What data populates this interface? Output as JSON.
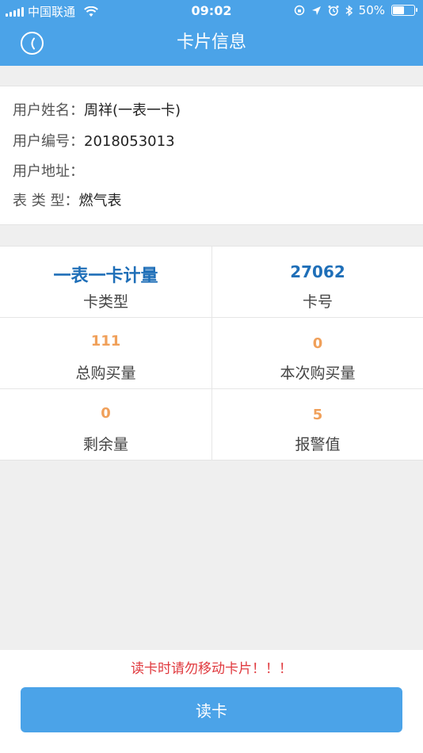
{
  "status_bar": {
    "carrier": "中国联通",
    "time": "09:02",
    "battery": "50%",
    "battery_level": 0.5
  },
  "header": {
    "title": "卡片信息",
    "back_icon": "back-circle-icon"
  },
  "user_info": {
    "name_label": "用户姓名：",
    "name_value": "周祥(一表一卡)",
    "number_label": "用户编号：",
    "number_value": "2018053013",
    "address_label": "用户地址：",
    "address_value": "",
    "meter_label": "表 类 型：",
    "meter_value": "燃气表"
  },
  "card_grid": [
    {
      "value": "一表一卡计量",
      "label": "卡类型"
    },
    {
      "value": "27062",
      "label": "卡号"
    },
    {
      "value": "111",
      "label": "总购买量"
    },
    {
      "value": "0",
      "label": "本次购买量"
    },
    {
      "value": "0",
      "label": "剩余量"
    },
    {
      "value": "5",
      "label": "报警值"
    }
  ],
  "colors": {
    "primary": "#4ba3e8",
    "value_blue": "#1f6fb8",
    "value_orange": "#f0a05a",
    "warning_red": "#e0393e"
  },
  "footer": {
    "warning": "读卡时请勿移动卡片！！！",
    "read_button": "读卡"
  }
}
